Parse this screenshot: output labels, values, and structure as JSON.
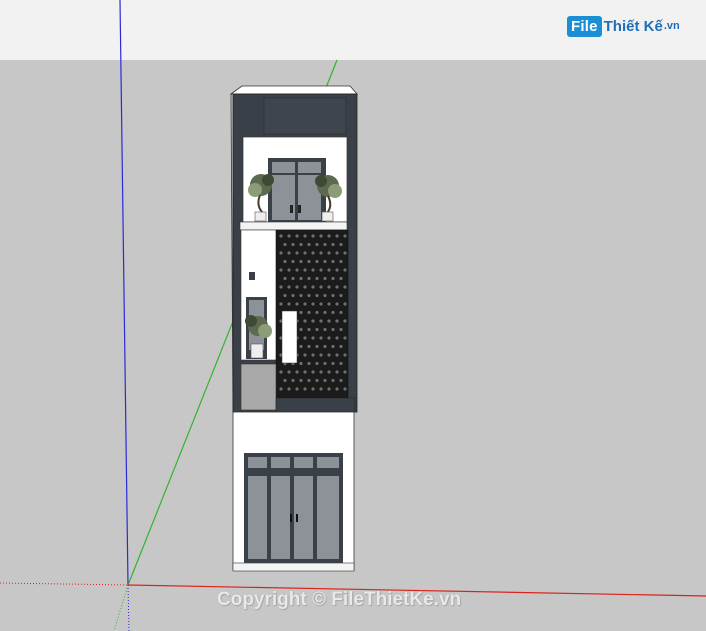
{
  "watermark": {
    "logo_badge": "File",
    "logo_rest": "Thiết Kế",
    "logo_ext": ".vn",
    "copyright": "Copyright © FileThietKe.vn"
  },
  "colors": {
    "sky": "#f2f2f2",
    "ground": "#c7c7c7",
    "wall_white": "#ffffff",
    "frame_dark": "#3a4048",
    "screen_black": "#1b1b1b",
    "glass": "#8d9198",
    "axis_red": "#d9241b",
    "axis_green": "#2fb52f",
    "axis_blue": "#2b2bd6",
    "logo_blue": "#1a8fd6"
  },
  "icons": {
    "axes": "sketchup-axes-icon",
    "plant": "potted-plant-icon"
  }
}
